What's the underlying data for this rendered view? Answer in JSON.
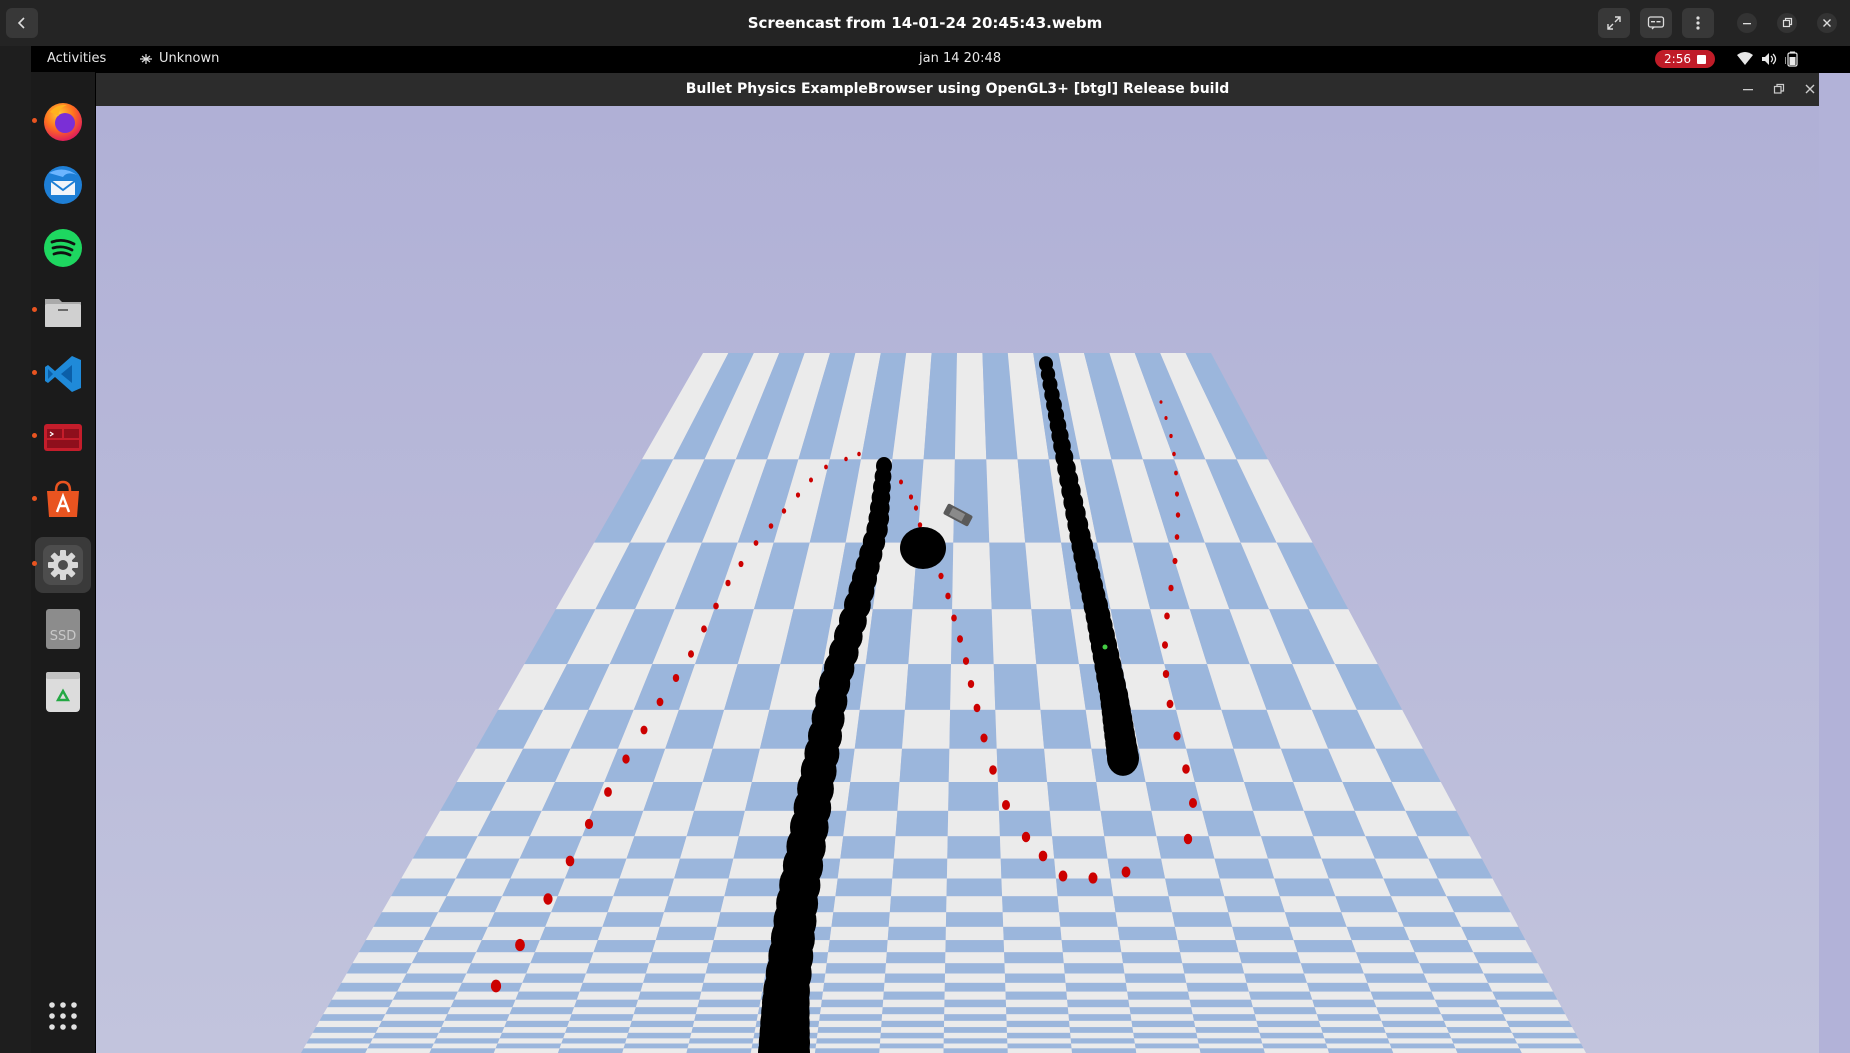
{
  "player": {
    "title": "Screencast from 14-01-24 20:45:43.webm",
    "buttons": [
      "back-icon",
      "fullscreen-icon",
      "subtitles-icon",
      "menu-icon",
      "minimize-icon",
      "restore-icon",
      "close-icon"
    ]
  },
  "topbar": {
    "activities": "Activities",
    "app_menu": "Unknown",
    "clock": "jan 14  20:48",
    "recording_time": "2:56"
  },
  "dock": {
    "items": [
      {
        "name": "firefox-icon",
        "running": true
      },
      {
        "name": "thunderbird-icon",
        "running": false
      },
      {
        "name": "spotify-icon",
        "running": false
      },
      {
        "name": "files-icon",
        "running": true
      },
      {
        "name": "vscode-icon",
        "running": true
      },
      {
        "name": "terminal-icon",
        "running": true
      },
      {
        "name": "app-center-icon",
        "running": true
      },
      {
        "name": "settings-icon",
        "running": true,
        "active": true
      },
      {
        "name": "ssd-drive-icon",
        "label": "SSD"
      },
      {
        "name": "trash-icon"
      },
      {
        "name": "show-apps-icon"
      }
    ]
  },
  "app": {
    "title": "Bullet Physics ExampleBrowser using OpenGL3+ [btgl] Release build"
  },
  "colors": {
    "sky": "#b2b2d8",
    "checker_light": "#ebebeb",
    "checker_dark": "#9bb6dc",
    "spheres": "#000000",
    "markers": "#cc0000",
    "recording": "#c01c28"
  }
}
